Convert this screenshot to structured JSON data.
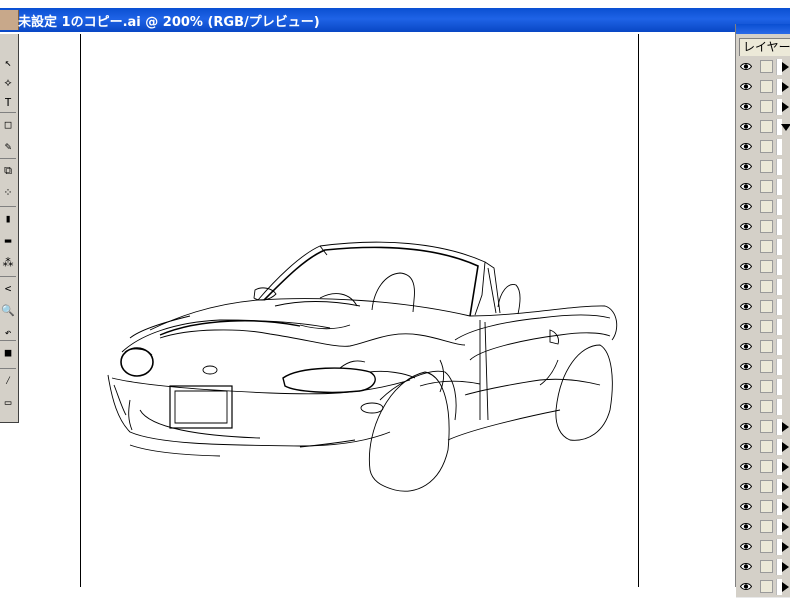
{
  "window": {
    "title": "未設定 1のコピー.ai @ 200% (RGB/プレビュー)"
  },
  "toolbox": {
    "tools": [
      {
        "icon": "direct-select-icon",
        "glyph": "↖"
      },
      {
        "icon": "magic-wand-icon",
        "glyph": "⟡"
      },
      {
        "icon": "type-icon",
        "glyph": "T"
      },
      {
        "icon": "rectangle-icon",
        "glyph": "□"
      },
      {
        "icon": "pencil-icon",
        "glyph": "✎"
      },
      {
        "icon": "scale-icon",
        "glyph": "⧉"
      },
      {
        "icon": "free-transform-icon",
        "glyph": "⁘"
      },
      {
        "icon": "graph-icon",
        "glyph": "▮"
      },
      {
        "icon": "gradient-icon",
        "glyph": "▬"
      },
      {
        "icon": "symbol-sprayer-icon",
        "glyph": "⁂"
      },
      {
        "icon": "slice-icon",
        "glyph": "<"
      },
      {
        "icon": "zoom-icon",
        "glyph": "🔍"
      },
      {
        "icon": "swap-colors-icon",
        "glyph": "↶"
      },
      {
        "icon": "fill-stroke-icon",
        "glyph": "■"
      },
      {
        "icon": "none-color-icon",
        "glyph": "⁄"
      },
      {
        "icon": "screen-mode-icon",
        "glyph": "▭"
      }
    ]
  },
  "layers_panel": {
    "tab_label": "レイヤー",
    "row_count": 27,
    "expanded_row_index": 3,
    "rows_with_expander": [
      0,
      1,
      2,
      3,
      18,
      19,
      20,
      21,
      22,
      23,
      24,
      25,
      26
    ]
  }
}
